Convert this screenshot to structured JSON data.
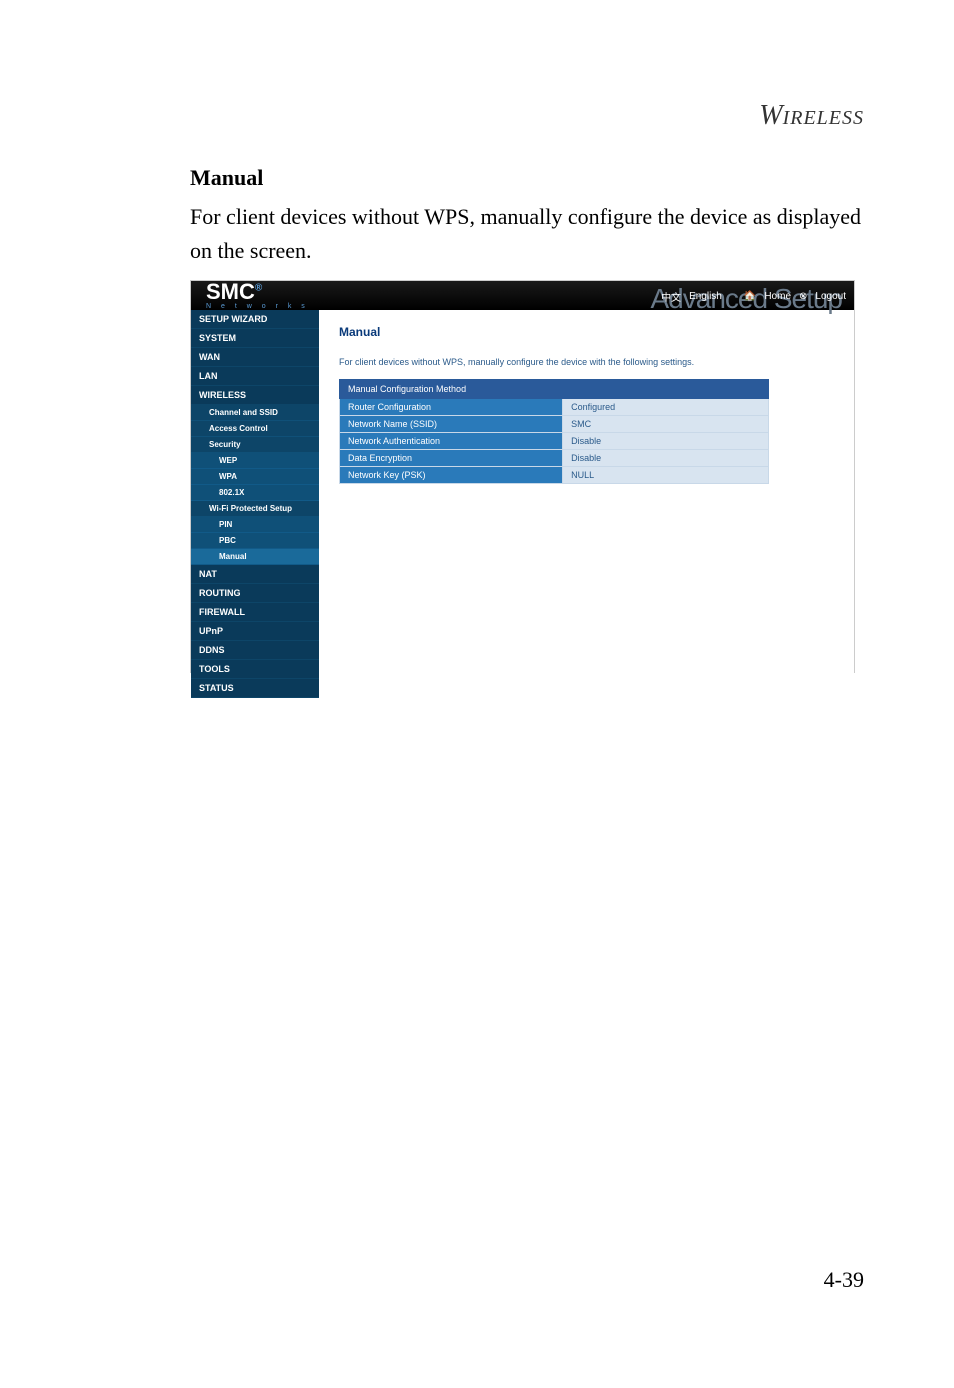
{
  "page_header_w": "W",
  "page_header_rest": "IRELESS",
  "section_title": "Manual",
  "intro_text": "For client devices without WPS, manually configure the device as displayed on the screen.",
  "page_number": "4-39",
  "panel": {
    "logo_main": "SMC",
    "logo_reg": "®",
    "logo_sub": "N e t w o r k s",
    "banner_text": "Advanced Setup",
    "lang_cn": "中文",
    "lang_en": "English",
    "home_label": "Home",
    "logout_label": "Logout"
  },
  "nav": {
    "setup_wizard": "SETUP WIZARD",
    "system": "SYSTEM",
    "wan": "WAN",
    "lan": "LAN",
    "wireless": "WIRELESS",
    "channel_ssid": "Channel and SSID",
    "access_control": "Access Control",
    "security": "Security",
    "wep": "WEP",
    "wpa": "WPA",
    "x802": "802.1X",
    "wifi_protected": "Wi-Fi Protected Setup",
    "pin": "PIN",
    "pbc": "PBC",
    "manual": "Manual",
    "nat": "NAT",
    "routing": "ROUTING",
    "firewall": "FIREWALL",
    "upnp": "UPnP",
    "ddns": "DDNS",
    "tools": "TOOLS",
    "status": "STATUS"
  },
  "content": {
    "title": "Manual",
    "desc": "For client devices without WPS, manually configure the device with the following settings.",
    "table_header": "Manual Configuration Method",
    "rows": [
      {
        "label": "Router Configuration",
        "value": "Configured"
      },
      {
        "label": "Network Name (SSID)",
        "value": "SMC"
      },
      {
        "label": "Network Authentication",
        "value": "Disable"
      },
      {
        "label": "Data Encryption",
        "value": "Disable"
      },
      {
        "label": "Network Key (PSK)",
        "value": "NULL"
      }
    ]
  }
}
